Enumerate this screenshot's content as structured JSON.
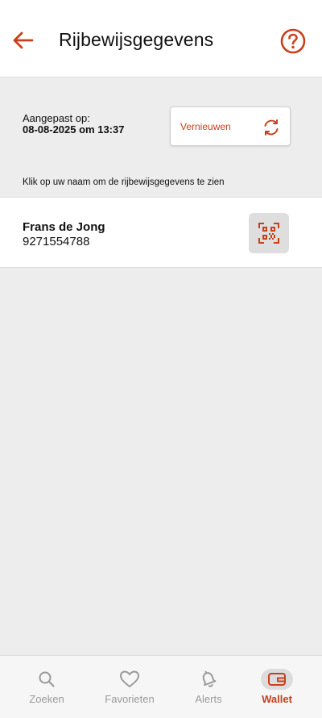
{
  "header": {
    "title": "Rijbewijsgegevens",
    "back_icon": "arrow-left-icon",
    "help_icon": "question-circle-icon"
  },
  "status": {
    "updated_label": "Aangepast op:",
    "updated_value": "08-08-2025 om 13:37"
  },
  "refresh": {
    "label": "Vernieuwen",
    "icon": "refresh-icon"
  },
  "instruction": "Klik op uw naam om de rijbewijsgegevens te zien",
  "license": {
    "name": "Frans de Jong",
    "number": "9271554788",
    "qr_icon": "qr-code-icon"
  },
  "bottom_nav": {
    "items": [
      {
        "label": "Zoeken",
        "icon": "search-icon",
        "active": false
      },
      {
        "label": "Favorieten",
        "icon": "heart-icon",
        "active": false
      },
      {
        "label": "Alerts",
        "icon": "bell-icon",
        "active": false
      },
      {
        "label": "Wallet",
        "icon": "wallet-icon",
        "active": true
      }
    ]
  },
  "colors": {
    "accent": "#c8401b",
    "background": "#ededed",
    "surface": "#ffffff",
    "inactive": "#9a9a9a"
  }
}
